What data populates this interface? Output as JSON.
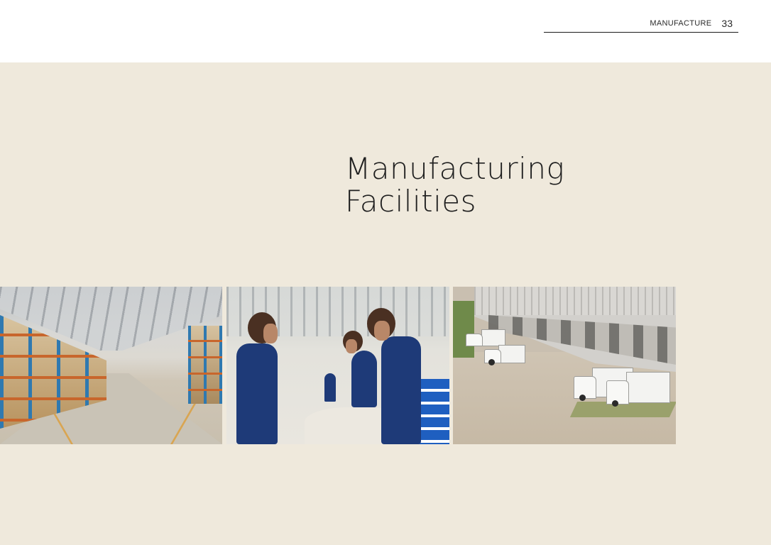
{
  "header": {
    "section_label": "MANUFACTURE",
    "page_number": "33"
  },
  "main": {
    "title_line1": "Manufacturing",
    "title_line2": "Facilities"
  },
  "colors": {
    "panel_background": "#efe9dc",
    "page_background": "#ffffff",
    "title_text": "#1f1f1f"
  }
}
